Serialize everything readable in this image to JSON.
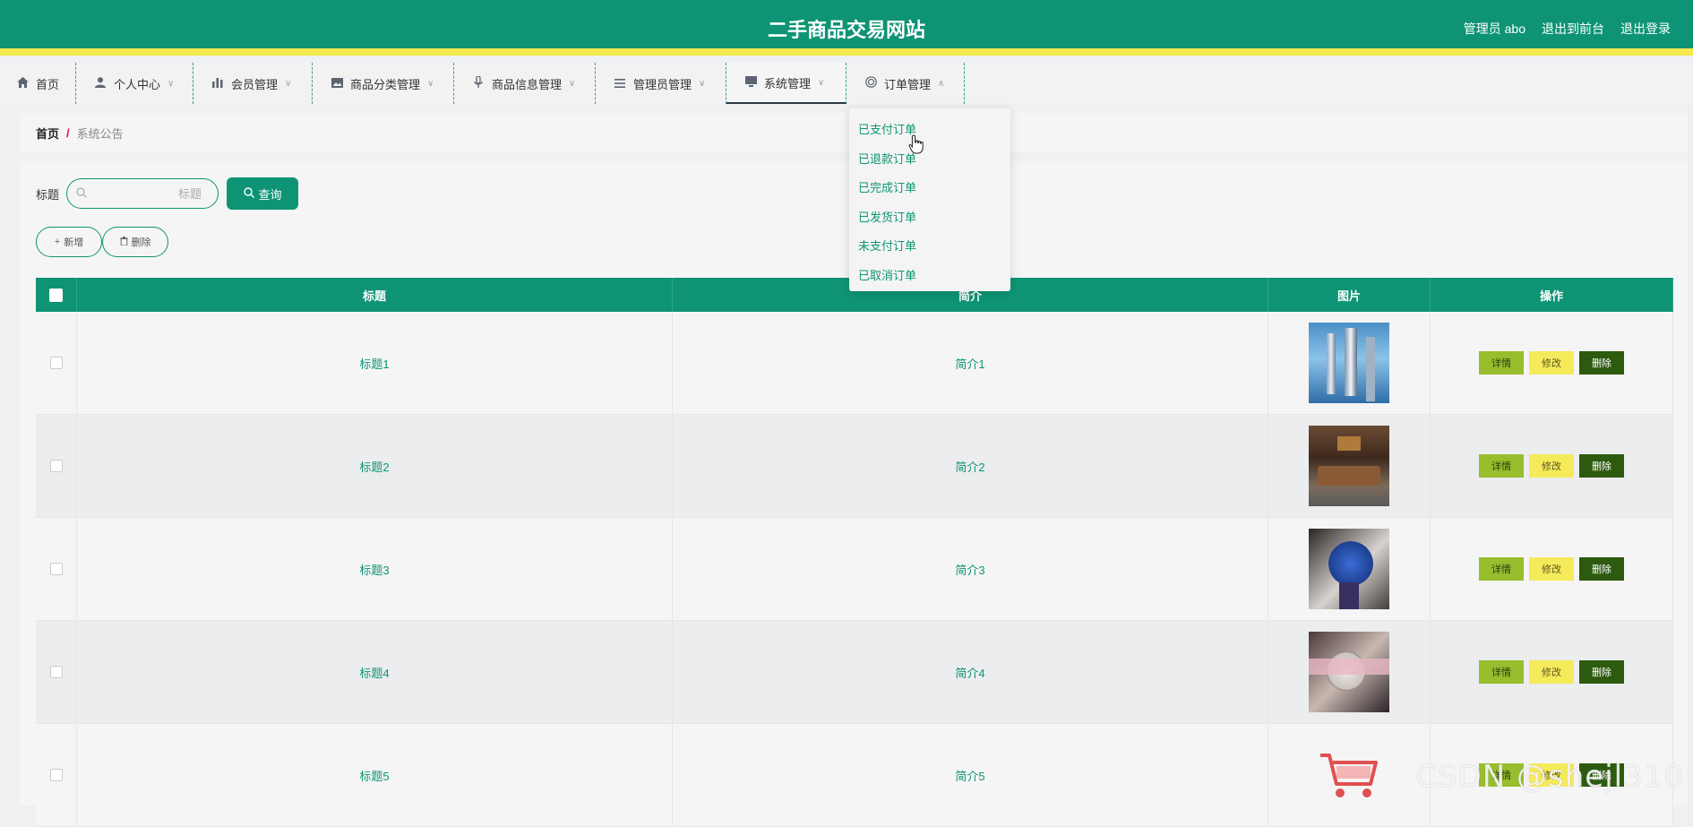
{
  "header": {
    "title": "二手商品交易网站",
    "admin_label": "管理员 abo",
    "back_to_front": "退出到前台",
    "logout": "退出登录",
    "brand_color": "#0e9474",
    "stripe_color": "#f5e94e"
  },
  "nav": {
    "home": "首页",
    "items": [
      {
        "label": "个人中心",
        "icon": "person-icon"
      },
      {
        "label": "会员管理",
        "icon": "bar-chart-icon"
      },
      {
        "label": "商品分类管理",
        "icon": "image-icon"
      },
      {
        "label": "商品信息管理",
        "icon": "microphone-icon"
      },
      {
        "label": "管理员管理",
        "icon": "list-icon"
      },
      {
        "label": "系统管理",
        "icon": "monitor-icon"
      },
      {
        "label": "订单管理",
        "icon": "target-icon"
      }
    ]
  },
  "dropdown": {
    "items": [
      "已支付订单",
      "已退款订单",
      "已完成订单",
      "已发货订单",
      "未支付订单",
      "已取消订单"
    ]
  },
  "breadcrumb": {
    "home": "首页",
    "separator": "/",
    "current": "系统公告"
  },
  "search": {
    "label": "标题",
    "placeholder": "标题",
    "button": "查询"
  },
  "actions": {
    "add": "新增",
    "delete": "删除"
  },
  "table": {
    "headers": {
      "title": "标题",
      "intro": "简介",
      "image": "图片",
      "ops": "操作"
    },
    "rows": [
      {
        "title": "标题1",
        "intro": "简介1"
      },
      {
        "title": "标题2",
        "intro": "简介2"
      },
      {
        "title": "标题3",
        "intro": "简介3"
      },
      {
        "title": "标题4",
        "intro": "简介4"
      },
      {
        "title": "标题5",
        "intro": "简介5"
      }
    ],
    "op_labels": {
      "detail": "详情",
      "edit": "修改",
      "delete": "删除"
    }
  },
  "watermark": "CSDN @shejl310"
}
